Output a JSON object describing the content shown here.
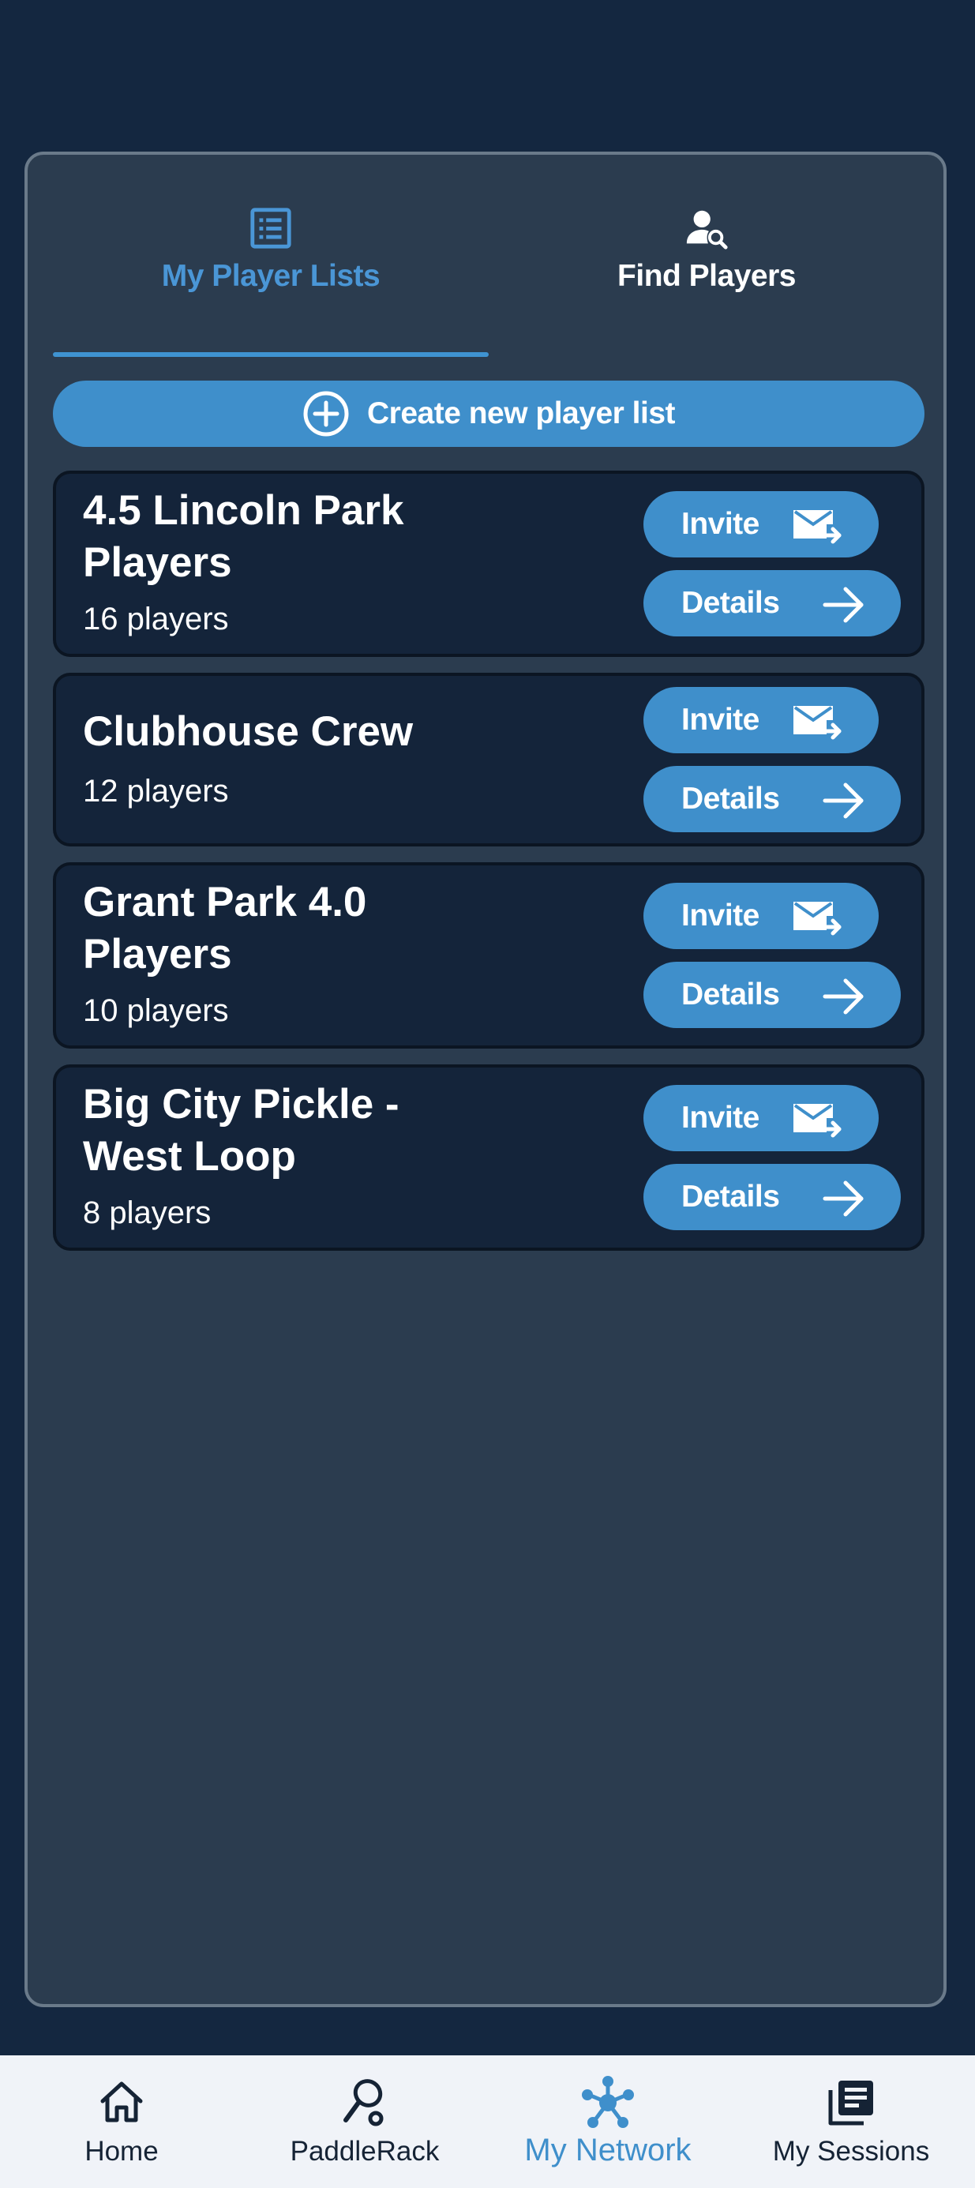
{
  "tabs": [
    {
      "label": "My Player Lists",
      "icon": "list-icon",
      "active": true
    },
    {
      "label": "Find Players",
      "icon": "person-search-icon",
      "active": false
    }
  ],
  "create_button": {
    "label": "Create new player list",
    "icon": "add-circle-icon"
  },
  "player_lists": [
    {
      "name": "4.5 Lincoln Park Players",
      "count": "16 players",
      "invite_label": "Invite",
      "details_label": "Details"
    },
    {
      "name": "Clubhouse Crew",
      "count": "12 players",
      "invite_label": "Invite",
      "details_label": "Details"
    },
    {
      "name": "Grant Park 4.0 Players",
      "count": "10 players",
      "invite_label": "Invite",
      "details_label": "Details"
    },
    {
      "name": "Big City Pickle - West Loop",
      "count": "8 players",
      "invite_label": "Invite",
      "details_label": "Details"
    }
  ],
  "bottom_nav": [
    {
      "label": "Home",
      "icon": "home-icon",
      "active": false
    },
    {
      "label": "PaddleRack",
      "icon": "paddle-icon",
      "active": false
    },
    {
      "label": "My Network",
      "icon": "network-icon",
      "active": true
    },
    {
      "label": "My Sessions",
      "icon": "sessions-icon",
      "active": false
    }
  ],
  "colors": {
    "accent": "#3f8fcb",
    "active_text": "#4a96d6",
    "background": "#142740",
    "panel": "#2b3c4f",
    "card": "#14243a",
    "nav_background": "#f0f3f8"
  }
}
